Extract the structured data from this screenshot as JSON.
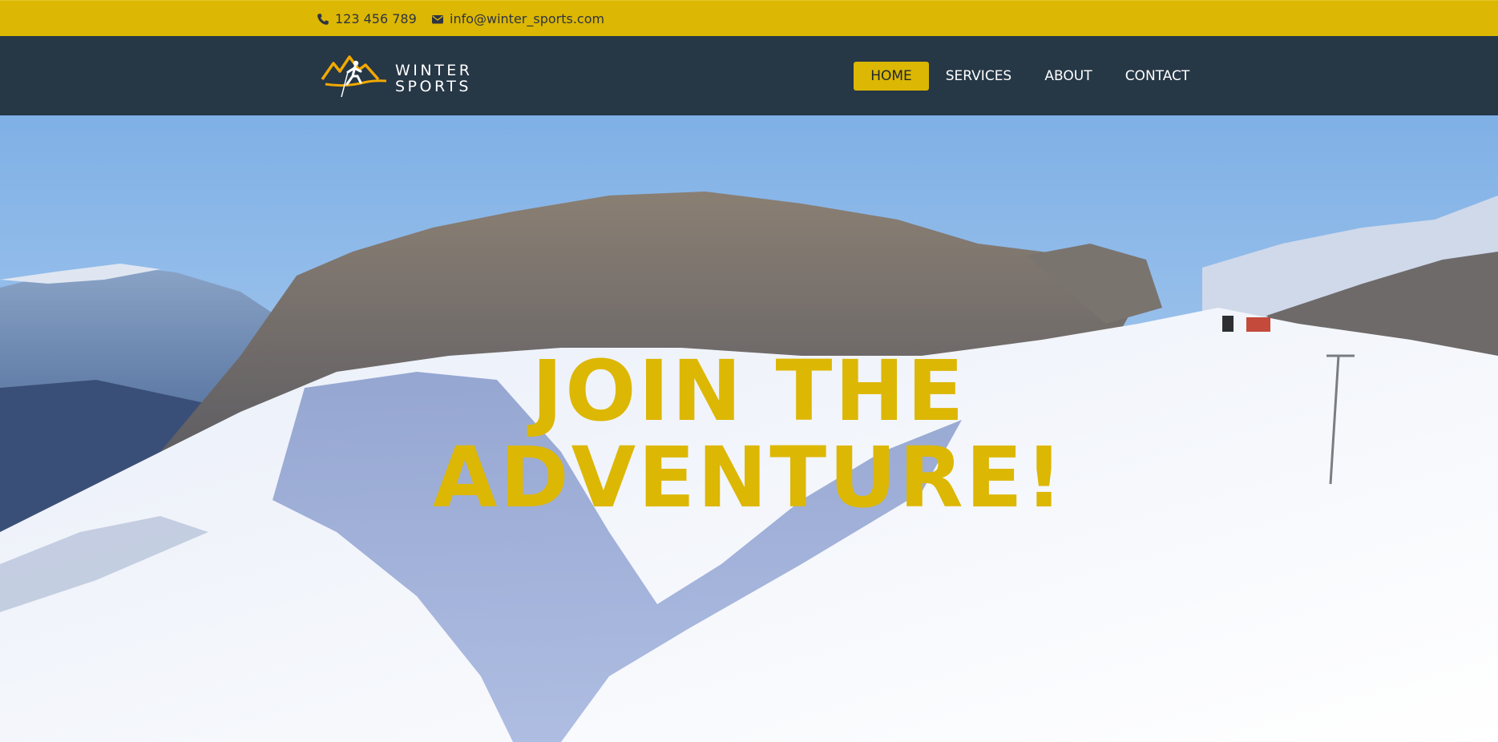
{
  "topbar": {
    "phone": "123 456 789",
    "email": "info@winter_sports.com",
    "phone_icon": "phone-icon",
    "email_icon": "envelope-icon"
  },
  "brand": {
    "line1": "WINTER",
    "line2": "SPORTS",
    "logo_icon": "mountain-skier-logo"
  },
  "nav": {
    "home": "HOME",
    "services": "SERVICES",
    "about": "ABOUT",
    "contact": "CONTACT",
    "active": "HOME"
  },
  "hero": {
    "line1": "JOIN THE",
    "line2": "ADVENTURE!"
  },
  "colors": {
    "accent": "#dcb703",
    "nav_bg": "#263746",
    "text_dark": "#2d3442"
  }
}
